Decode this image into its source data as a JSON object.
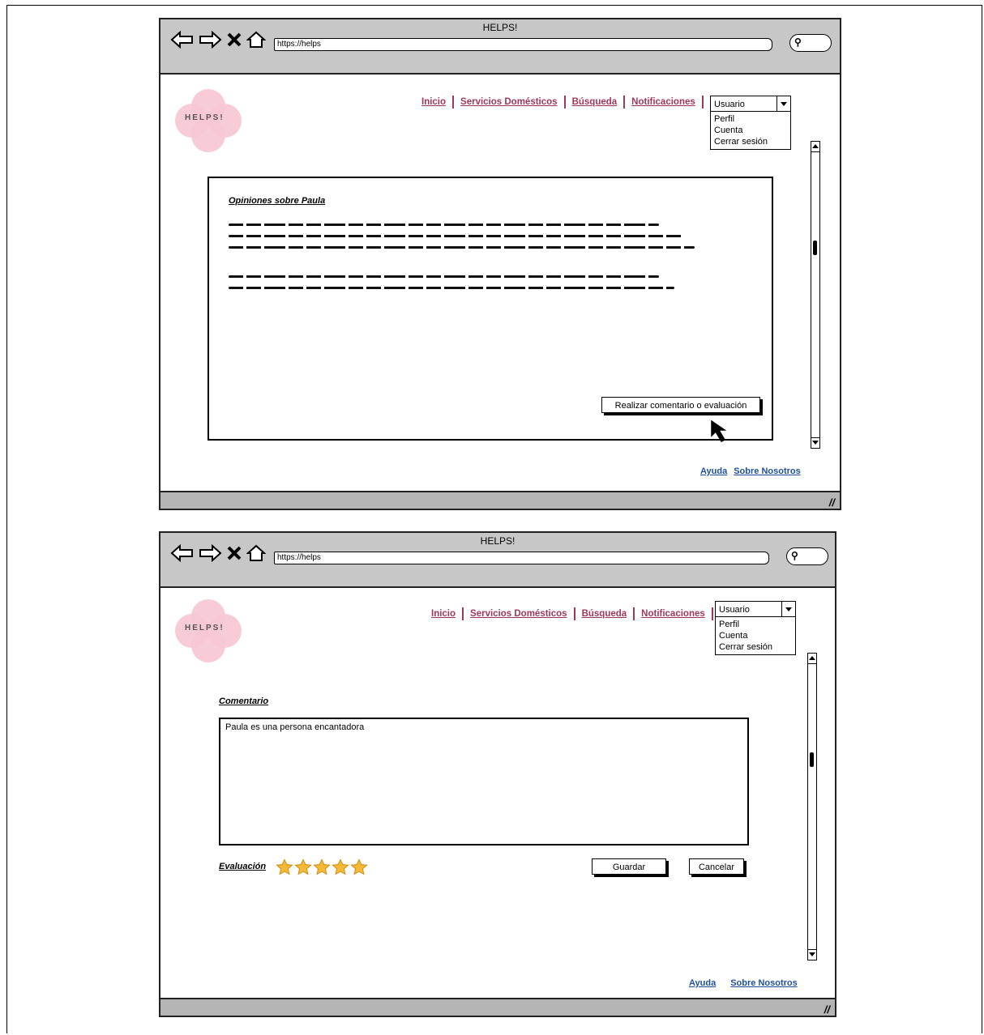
{
  "window_title": "HELPS!",
  "url": "https://helps",
  "logo": {
    "text": "HELPS!"
  },
  "nav": [
    "Inicio",
    "Servicios Domésticos",
    "Búsqueda",
    "Notificaciones"
  ],
  "user_menu": {
    "selected": "Usuario",
    "options": [
      "Perfil",
      "Cuenta",
      "Cerrar sesión"
    ]
  },
  "footer": {
    "help": "Ayuda",
    "about": "Sobre Nosotros"
  },
  "screen1": {
    "heading": "Opiniones sobre Paula",
    "button": "Realizar comentario o evaluación"
  },
  "screen2": {
    "comment_heading": "Comentario",
    "comment_value": "Paula es una persona encantadora",
    "rating_label": "Evaluación",
    "rating": 5,
    "save": "Guardar",
    "cancel": "Cancelar"
  },
  "colors": {
    "nav_link": "#a0375b",
    "footer_link": "#1f4f99",
    "logo_pink": "#f6c8d3",
    "star": "#f5b935",
    "chrome": "#c7c7c7"
  }
}
